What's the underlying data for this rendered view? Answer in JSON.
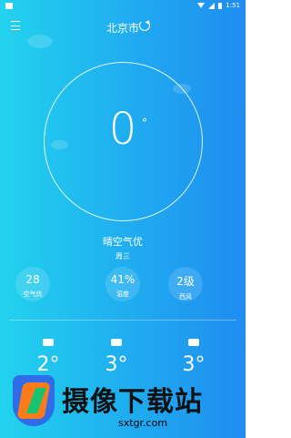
{
  "status": {
    "time": "1:51"
  },
  "header": {
    "city": "北京市"
  },
  "current": {
    "temperature": "0",
    "degree_symbol": "°",
    "condition": "晴空气优",
    "weekday": "周三"
  },
  "stats": [
    {
      "value": "28",
      "label": "空气优"
    },
    {
      "value": "41%",
      "label": "湿度"
    },
    {
      "value": "2级",
      "label": "西风"
    }
  ],
  "forecast": [
    {
      "temp": "2°"
    },
    {
      "temp": "3°"
    },
    {
      "temp": "3°"
    }
  ],
  "watermark": {
    "title": "摄像下载站",
    "url": "sxtgr.com"
  },
  "colors": {
    "gradient_start": "#22d3ee",
    "gradient_end": "#1f8cf0"
  }
}
